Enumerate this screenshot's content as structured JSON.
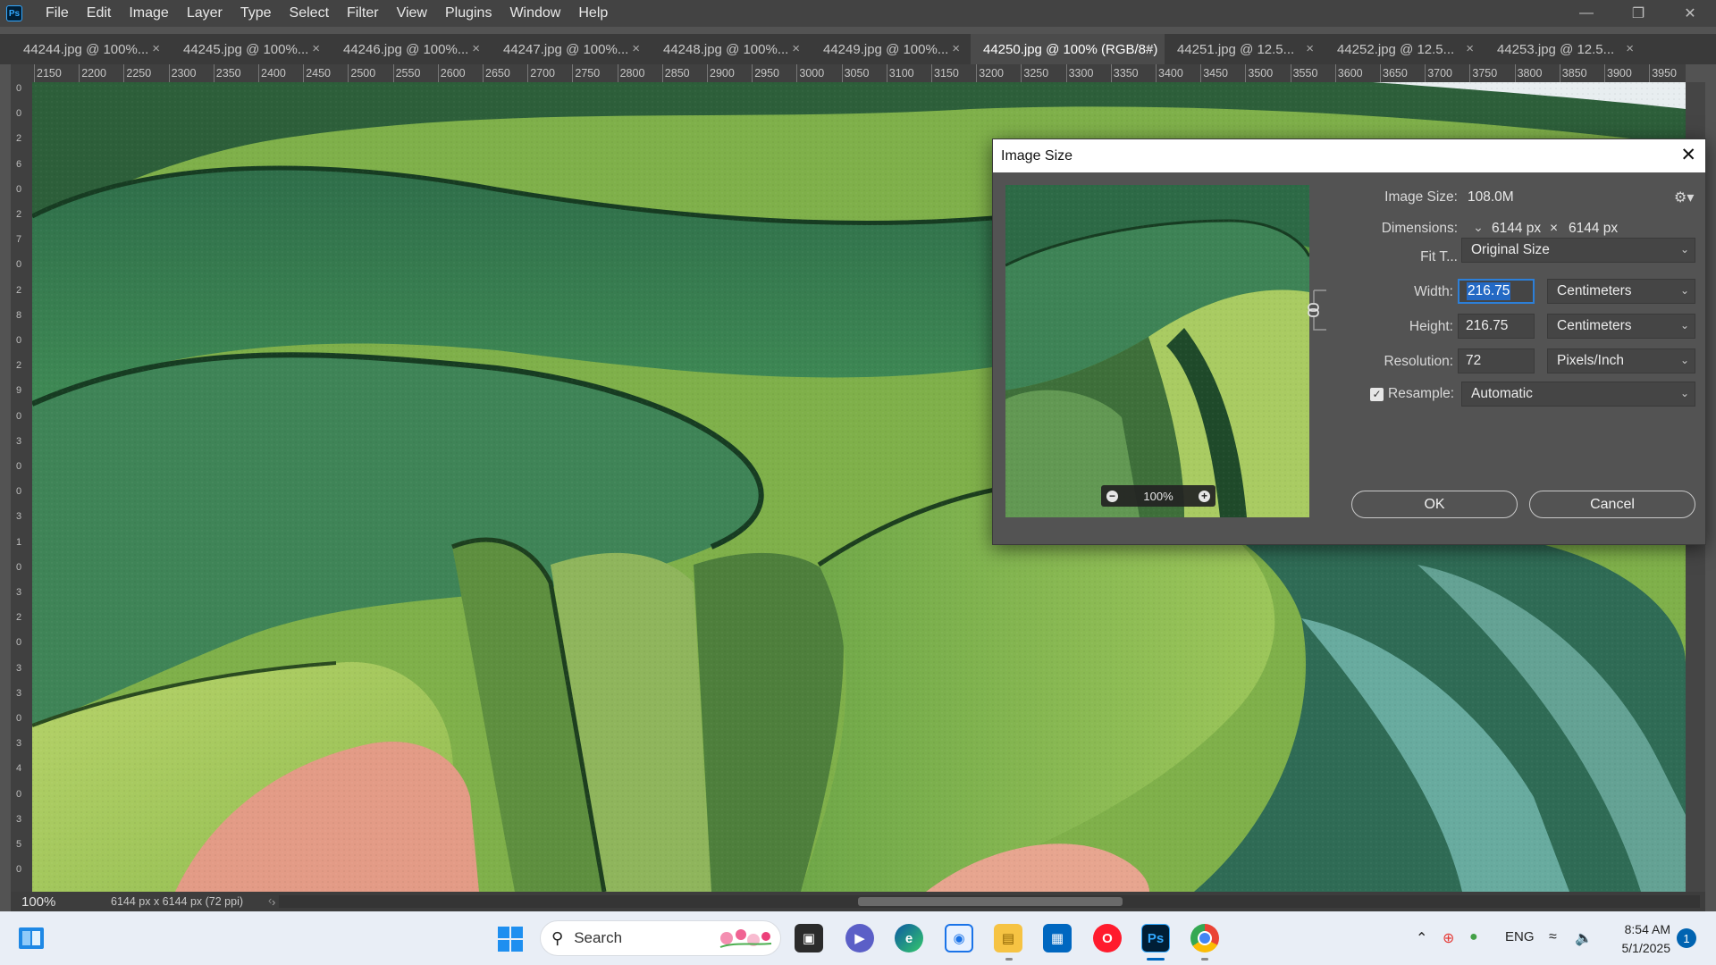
{
  "app": {
    "logo": "Ps"
  },
  "menu": [
    "File",
    "Edit",
    "Image",
    "Layer",
    "Type",
    "Select",
    "Filter",
    "View",
    "Plugins",
    "Window",
    "Help"
  ],
  "tabs": [
    {
      "label": "44244.jpg @ 100%...",
      "active": false
    },
    {
      "label": "44245.jpg @ 100%...",
      "active": false
    },
    {
      "label": "44246.jpg @ 100%...",
      "active": false
    },
    {
      "label": "44247.jpg @ 100%...",
      "active": false
    },
    {
      "label": "44248.jpg @ 100%...",
      "active": false
    },
    {
      "label": "44249.jpg @ 100%...",
      "active": false
    },
    {
      "label": "44250.jpg @ 100% (RGB/8#)",
      "active": true
    },
    {
      "label": "44251.jpg @ 12.5...",
      "active": false
    },
    {
      "label": "44252.jpg @ 12.5...",
      "active": false
    },
    {
      "label": "44253.jpg @ 12.5...",
      "active": false
    }
  ],
  "ruler_h": [
    "2150",
    "2200",
    "2250",
    "2300",
    "2350",
    "2400",
    "2450",
    "2500",
    "2550",
    "2600",
    "2650",
    "2700",
    "2750",
    "2800",
    "2850",
    "2900",
    "2950",
    "3000",
    "3050",
    "3100",
    "3150",
    "3200",
    "3250",
    "3300",
    "3350",
    "3400",
    "3450",
    "3500",
    "3550",
    "3600",
    "3650",
    "3700",
    "3750",
    "3800",
    "3850",
    "3900",
    "3950"
  ],
  "ruler_v": [
    "0",
    "0",
    "2",
    "6",
    "0",
    "2",
    "7",
    "0",
    "2",
    "8",
    "0",
    "2",
    "9",
    "0",
    "3",
    "0",
    "0",
    "3",
    "1",
    "0",
    "3",
    "2",
    "0",
    "3",
    "3",
    "0",
    "3",
    "4",
    "0",
    "3",
    "5",
    "0"
  ],
  "status": {
    "zoom": "100%",
    "doc_info": "6144 px x 6144 px (72 ppi)"
  },
  "dialog": {
    "title": "Image Size",
    "image_size_label": "Image Size:",
    "image_size_value": "108.0M",
    "dimensions_label": "Dimensions:",
    "dim_width": "6144 px",
    "dim_x": "×",
    "dim_height": "6144 px",
    "fit_label": "Fit T...",
    "fit_value": "Original Size",
    "width_label": "Width:",
    "width_value": "216.75",
    "width_unit": "Centimeters",
    "height_label": "Height:",
    "height_value": "216.75",
    "height_unit": "Centimeters",
    "resolution_label": "Resolution:",
    "resolution_value": "72",
    "resolution_unit": "Pixels/Inch",
    "resample_label": "Resample:",
    "resample_checked": true,
    "resample_value": "Automatic",
    "preview_zoom": "100%",
    "ok_label": "OK",
    "cancel_label": "Cancel"
  },
  "taskbar": {
    "search_placeholder": "Search",
    "language": "ENG",
    "time": "8:54 AM",
    "date": "5/1/2025",
    "notifications": "1",
    "apps": [
      "file-manager",
      "teams-meet",
      "edge",
      "photos-app",
      "file-explorer",
      "microsoft-store",
      "opera",
      "photoshop",
      "chrome"
    ]
  },
  "colors": {
    "accent": "#2c7fd8",
    "ps_brand": "#31a8ff",
    "canvas_green": "#3f8a4a",
    "dialog_bg": "#535353",
    "menubar": "#434343"
  }
}
